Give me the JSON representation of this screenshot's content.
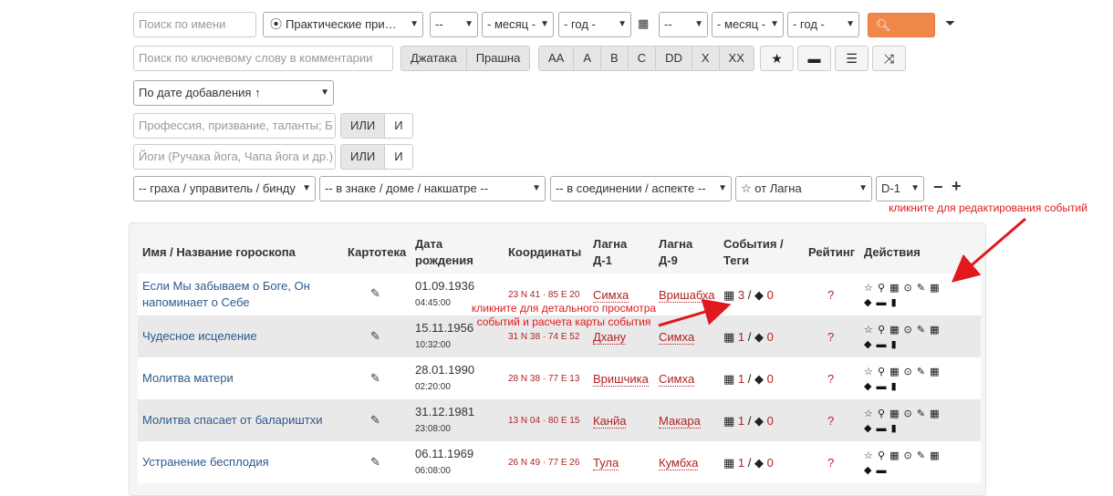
{
  "toolbar": {
    "name_placeholder": "Поиск по имени",
    "category_select": "Практические при…",
    "day1": "--",
    "month1": "- месяц -",
    "year1": "- год -",
    "day2": "--",
    "month2": "- месяц -",
    "year2": "- год -",
    "search_label": "Поиск",
    "comment_placeholder": "Поиск по ключевому слову в комментарии",
    "chart_types": [
      "Джатака",
      "Прашна"
    ],
    "ratings": [
      "AA",
      "A",
      "B",
      "C",
      "DD",
      "X",
      "XX"
    ],
    "sort_select": "По дате добавления ↑",
    "profession_placeholder": "Профессия, призвание, таланты; Б",
    "yoga_placeholder": "Йоги (Ручака йога, Чапа йога и др.)",
    "or_label": "ИЛИ",
    "and_label": "И",
    "graha_select": "-- граха / управитель / бинду",
    "sign_select": "-- в знаке / доме / накшатре --",
    "conjunction_select": "-- в соединении / аспекте --",
    "from_select": "☆ от Лагна",
    "division_select": "D-1",
    "minus": "−",
    "plus": "+"
  },
  "annotations": {
    "edit_events": "кликните для редактирования событий",
    "view_events": "кликните для детального просмотра событий и расчета карты события"
  },
  "table": {
    "headers": {
      "name": "Имя / Название гороскопа",
      "cardfile": "Картотека",
      "birth_date": "Дата рождения",
      "coords": "Координаты",
      "lagna_d1": "Лагна Д-1",
      "lagna_d9": "Лагна Д-9",
      "events": "События / Теги",
      "rating": "Рейтинг",
      "actions": "Действия"
    },
    "rows": [
      {
        "name": "Если Мы забываем о Боге, Он напоминает о Себе",
        "date": "01.09.1936",
        "time": "04:45:00",
        "coords": "23 N 41 · 85 E 20",
        "d1": "Симха",
        "d9": "Вришабха",
        "events": "3",
        "tags": "0",
        "rating": "?"
      },
      {
        "name": "Чудесное исцеление",
        "date": "15.11.1956",
        "time": "10:32:00",
        "coords": "31 N 38 · 74 E 52",
        "d1": "Дхану",
        "d9": "Симха",
        "events": "1",
        "tags": "0",
        "rating": "?"
      },
      {
        "name": "Молитва матери",
        "date": "28.01.1990",
        "time": "02:20:00",
        "coords": "28 N 38 · 77 E 13",
        "d1": "Вришчика",
        "d9": "Симха",
        "events": "1",
        "tags": "0",
        "rating": "?"
      },
      {
        "name": "Молитва спасает от балариштхи",
        "date": "31.12.1981",
        "time": "23:08:00",
        "coords": "13 N 04 · 80 E 15",
        "d1": "Канйа",
        "d9": "Макара",
        "events": "1",
        "tags": "0",
        "rating": "?"
      },
      {
        "name": "Устранение бесплодия",
        "date": "06.11.1969",
        "time": "06:08:00",
        "coords": "26 N 49 · 77 E 26",
        "d1": "Тула",
        "d9": "Кумбха",
        "events": "1",
        "tags": "0",
        "rating": "?"
      }
    ]
  },
  "colors": {
    "accent": "#f0884a",
    "link": "#2c5a8c",
    "value": "#b02222",
    "annotation": "#e0191e"
  }
}
